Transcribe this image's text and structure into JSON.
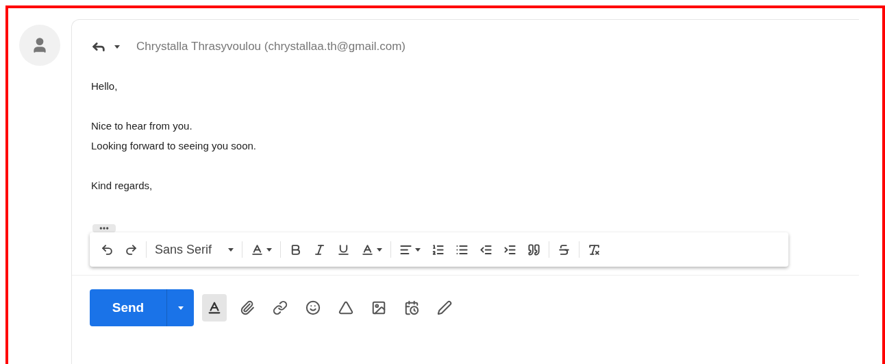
{
  "reply_header": {
    "sender": "Chrystalla Thrasyvoulou (chrystallaa.th@gmail.com)"
  },
  "body": {
    "paragraphs": [
      [
        "Hello,"
      ],
      [
        "Nice to hear from you.",
        "Looking forward to seeing you soon."
      ],
      [
        "Kind regards,"
      ]
    ]
  },
  "formatting_toolbar": {
    "font_name": "Sans Serif"
  },
  "bottom_bar": {
    "send_label": "Send",
    "formatting_toggle": {
      "selected": true
    }
  }
}
